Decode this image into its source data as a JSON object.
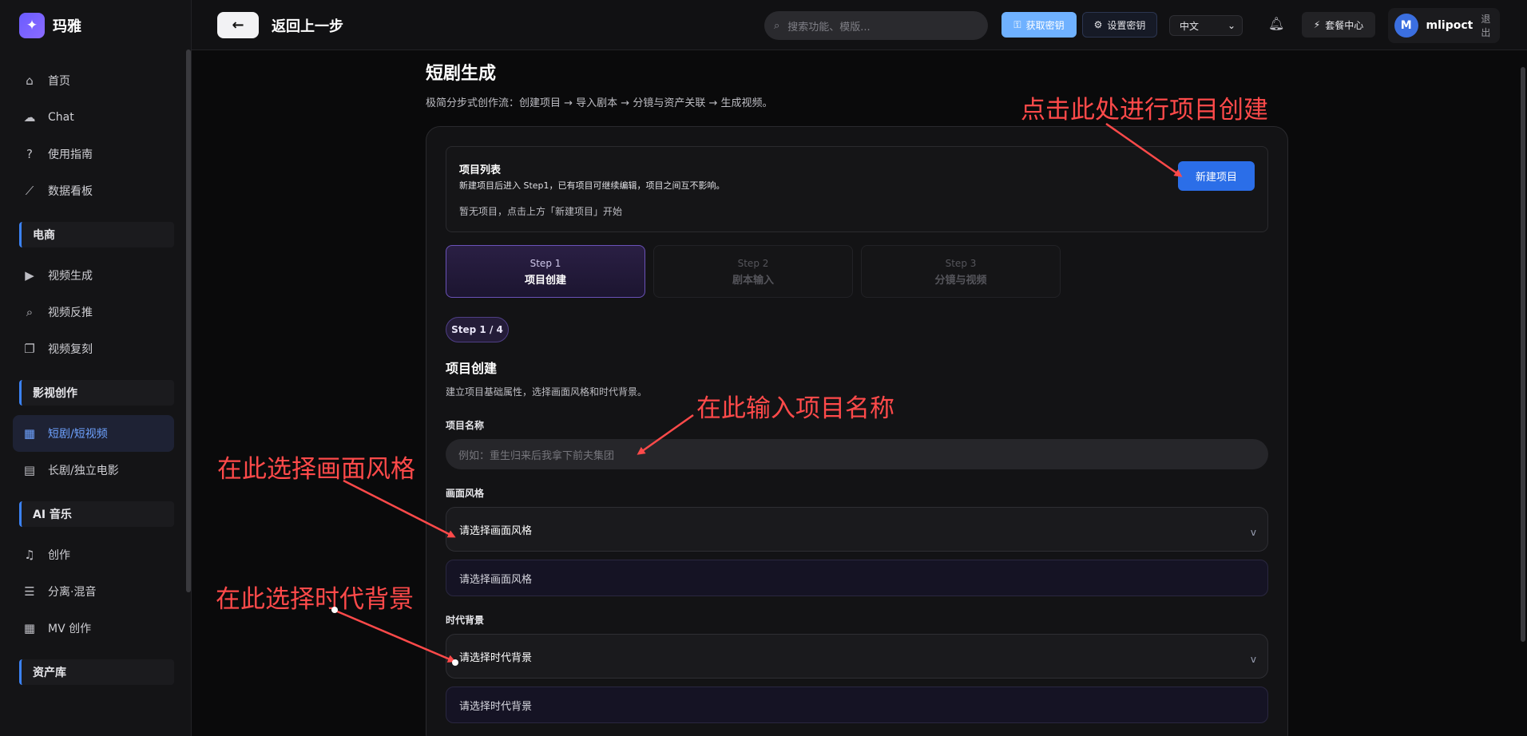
{
  "app": {
    "name": "玛雅",
    "logo_icon": "magic-wand-icon"
  },
  "sidebar": {
    "items_top": [
      {
        "label": "首页",
        "icon": "home-icon",
        "glyph": "⌂"
      },
      {
        "label": "Chat",
        "icon": "chat-icon",
        "glyph": "☁"
      },
      {
        "label": "使用指南",
        "icon": "help-icon",
        "glyph": "?"
      },
      {
        "label": "数据看板",
        "icon": "chart-icon",
        "glyph": "⟋"
      }
    ],
    "section_ecommerce": "电商",
    "items_ecommerce": [
      {
        "label": "视频生成",
        "icon": "video-camera-icon",
        "glyph": "▶"
      },
      {
        "label": "视频反推",
        "icon": "search-video-icon",
        "glyph": "⌕"
      },
      {
        "label": "视频复刻",
        "icon": "copy-icon",
        "glyph": "❐"
      }
    ],
    "section_film": "影视创作",
    "items_film": [
      {
        "label": "短剧/短视频",
        "icon": "film-icon",
        "glyph": "▦",
        "active": true
      },
      {
        "label": "长剧/独立电影",
        "icon": "clapperboard-icon",
        "glyph": "▤"
      }
    ],
    "section_music": "AI 音乐",
    "items_music": [
      {
        "label": "创作",
        "icon": "music-note-icon",
        "glyph": "♫"
      },
      {
        "label": "分离·混音",
        "icon": "sliders-icon",
        "glyph": "☰"
      },
      {
        "label": "MV 创作",
        "icon": "film-strip-icon",
        "glyph": "▦"
      }
    ],
    "section_assets": "资产库"
  },
  "header": {
    "back_label": "返回上一步",
    "search_placeholder": "搜索功能、模版...",
    "get_key": "获取密钥",
    "set_key": "设置密钥",
    "language": "中文",
    "package": "套餐中心",
    "avatar_letter": "M",
    "username": "mlipoct",
    "logout": "退出"
  },
  "main": {
    "title": "短剧生成",
    "subtitle": "极简分步式创作流：创建项目 → 导入剧本 → 分镜与资产关联 → 生成视频。",
    "project_list": {
      "title": "项目列表",
      "description": "新建项目后进入 Step1，已有项目可继续编辑，项目之间互不影响。",
      "empty": "暂无项目，点击上方「新建项目」开始",
      "new_button": "新建项目"
    },
    "steps": [
      {
        "step": "Step 1",
        "name": "项目创建",
        "active": true
      },
      {
        "step": "Step 2",
        "name": "剧本输入",
        "active": false
      },
      {
        "step": "Step 3",
        "name": "分镜与视频",
        "active": false
      }
    ],
    "step_badge": "Step 1 / 4",
    "section_title": "项目创建",
    "section_sub": "建立项目基础属性，选择画面风格和时代背景。",
    "name_label": "项目名称",
    "name_placeholder": "例如：重生归来后我拿下前夫集团",
    "style_label": "画面风格",
    "style_select": "请选择画面风格",
    "style_option": "请选择画面风格",
    "era_label": "时代背景",
    "era_select": "请选择时代背景",
    "era_option": "请选择时代背景"
  },
  "annotations": {
    "create_project": "点击此处进行项目创建",
    "enter_name": "在此输入项目名称",
    "choose_style": "在此选择画面风格",
    "choose_era": "在此选择时代背景",
    "color": "#ff4a4a"
  }
}
